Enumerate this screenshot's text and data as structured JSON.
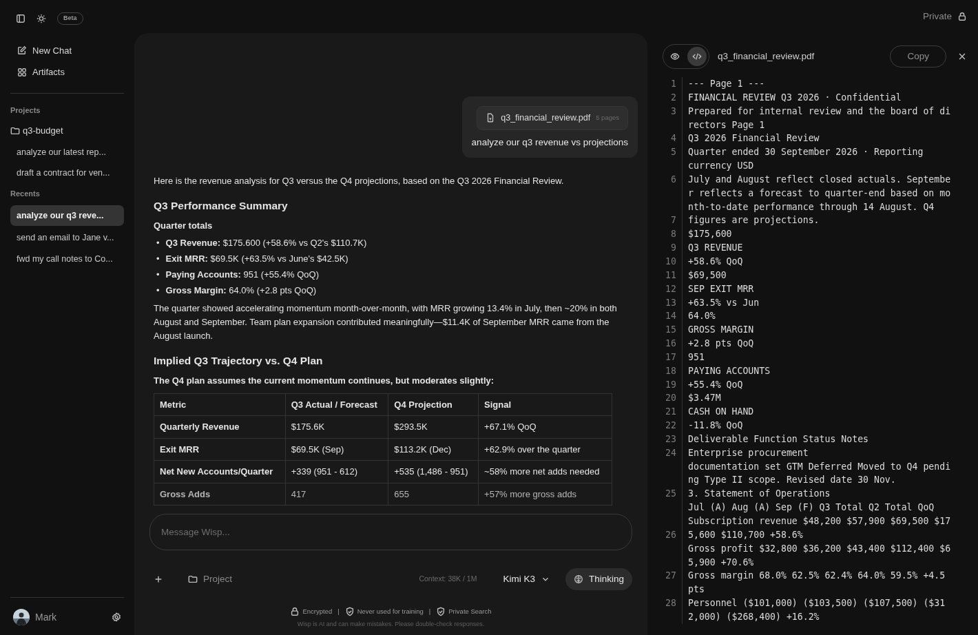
{
  "top_bar": {
    "badge": "Beta",
    "private_label": "Private"
  },
  "sidebar": {
    "nav": [
      {
        "kind": "compose",
        "label": "New Chat"
      },
      {
        "kind": "grid",
        "label": "Artifacts"
      }
    ],
    "projects_label": "Projects",
    "project": {
      "name": "q3-budget",
      "chats": [
        "analyze our latest rep...",
        "draft a contract for ven..."
      ]
    },
    "recents_label": "Recents",
    "recents": [
      {
        "title": "analyze our q3 reve...",
        "selected": true
      },
      {
        "title": "send an email to Jane v...",
        "selected": false
      },
      {
        "title": "fwd my call notes to Co...",
        "selected": false
      }
    ],
    "user": {
      "name": "Mark"
    }
  },
  "chat": {
    "attachment": {
      "filename": "q3_financial_review.pdf",
      "pages": "5 pages"
    },
    "user_message": "analyze our q3 revenue vs projections",
    "blocks": [
      {
        "kind": "p",
        "text": "Here is the revenue analysis for Q3 versus the Q4 projections, based on the Q3 2026 Financial Review."
      },
      {
        "kind": "h",
        "text": "Q3 Performance Summary"
      },
      {
        "kind": "sub",
        "text": "Quarter totals"
      },
      {
        "kind": "ul",
        "items": [
          {
            "marker": "•",
            "text": "**Q3 Revenue:** $175.600 (+58.6% vs Q2's $110.7K)"
          },
          {
            "marker": "•",
            "text": "**Exit MRR:** $69.5K (+63.5% vs June's $42.5K)"
          },
          {
            "marker": "•",
            "text": "**Paying Accounts:** 951 (+55.4% QoQ)"
          },
          {
            "marker": "•",
            "text": "**Gross Margin:** 64.0% (+2.8 pts QoQ)"
          }
        ]
      },
      {
        "kind": "p",
        "text": "The quarter showed accelerating momentum month-over-month, with MRR growing 13.4% in July, then ~20% in both August and September. Team plan expansion contributed meaningfully—$11.4K of September MRR came from the August launch."
      },
      {
        "kind": "h",
        "text": "Implied Q3 Trajectory vs. Q4 Plan"
      },
      {
        "kind": "sub",
        "text": "The Q4 plan assumes the current momentum continues, but moderates slightly:"
      },
      {
        "kind": "table",
        "columns": [
          "Metric",
          "Q3 Actual / Forecast",
          "Q4 Projection",
          "Signal"
        ],
        "rows": [
          [
            "Quarterly Revenue",
            "$175.6K",
            "$293.5K",
            "+67.1% QoQ"
          ],
          [
            "Exit MRR",
            "$69.5K (Sep)",
            "$113.2K (Dec)",
            "+62.9% over the quarter"
          ],
          [
            "Net New Accounts/Quarter",
            "+339 (951 - 612)",
            "+535 (1,486 - 951)",
            "~58% more net adds needed"
          ],
          [
            "Gross Adds",
            "417",
            "655",
            "+57% more gross adds"
          ]
        ]
      }
    ],
    "composer": {
      "placeholder": "Message Wisp...",
      "project_label": "Project",
      "context": "Context: 38K / 1M",
      "model": "Kimi K3",
      "thinking": {
        "label": "Thinking",
        "on": true
      }
    },
    "footer": {
      "separators": [
        "|",
        "|"
      ],
      "badges": [
        {
          "kind": "lock",
          "label": "Encrypted"
        },
        {
          "kind": "shield",
          "label": "Never used for training"
        },
        {
          "kind": "shield",
          "label": "Private Search"
        }
      ],
      "disclaimer": "Wisp is AI and can make mistakes. Please double-check responses."
    }
  },
  "viewer": {
    "modes": [
      {
        "kind": "preview",
        "selected": false
      },
      {
        "kind": "source",
        "selected": true
      }
    ],
    "filename": "q3_financial_review.pdf",
    "copy_label": "Copy",
    "lines": [
      {
        "number": "1",
        "text": "--- Page 1 ---"
      },
      {
        "number": "2",
        "text": "FINANCIAL REVIEW Q3 2026 · Confidential"
      },
      {
        "number": "3",
        "text": "Prepared for internal review and the board of directors Page 1"
      },
      {
        "number": "4",
        "text": "Q3 2026 Financial Review"
      },
      {
        "number": "5",
        "text": "Quarter ended 30 September 2026 · Reporting\ncurrency USD"
      },
      {
        "number": "6",
        "text": "July and August reflect closed actuals. September reflects a forecast to quarter-end based on month-to-date performance through 14 August. Q4"
      },
      {
        "number": "7",
        "text": "figures are projections."
      },
      {
        "number": "8",
        "text": "$175,600"
      },
      {
        "number": "9",
        "text": "Q3 REVENUE"
      },
      {
        "number": "10",
        "text": "+58.6% QoQ"
      },
      {
        "number": "11",
        "text": "$69,500"
      },
      {
        "number": "12",
        "text": "SEP EXIT MRR"
      },
      {
        "number": "13",
        "text": "+63.5% vs Jun"
      },
      {
        "number": "14",
        "text": "64.0%"
      },
      {
        "number": "15",
        "text": "GROSS MARGIN"
      },
      {
        "number": "16",
        "text": "+2.8 pts QoQ"
      },
      {
        "number": "17",
        "text": "951"
      },
      {
        "number": "18",
        "text": "PAYING ACCOUNTS"
      },
      {
        "number": "19",
        "text": "+55.4% QoQ"
      },
      {
        "number": "20",
        "text": "$3.47M"
      },
      {
        "number": "21",
        "text": "CASH ON HAND"
      },
      {
        "number": "22",
        "text": "-11.8% QoQ"
      },
      {
        "number": "23",
        "text": "Deliverable Function Status Notes"
      },
      {
        "number": "24",
        "text": "Enterprise procurement\ndocumentation set GTM Deferred Moved to Q4 pending Type II scope. Revised date 30 Nov."
      },
      {
        "number": "25",
        "text": "3. Statement of Operations\nJul (A) Aug (A) Sep (F) Q3 Total Q2 Total QoQ\nSubscription revenue $48,200 $57,900 $69,500 $17"
      },
      {
        "number": "26",
        "text": "5,600 $110,700 +58.6%\nGross profit $32,800 $36,200 $43,400 $112,400 $65,900 +70.6%"
      },
      {
        "number": "27",
        "text": "Gross margin 68.0% 62.5% 62.4% 64.0% 59.5% +4.5 pts"
      },
      {
        "number": "28",
        "text": "Personnel ($101,000) ($103,500) ($107,500) ($312,000) ($268,400) +16.2%"
      }
    ]
  }
}
